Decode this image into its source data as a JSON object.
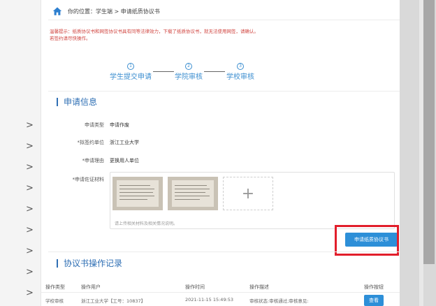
{
  "breadcrumb": {
    "prefix": "你的位置：",
    "path": "学生端 > 申请纸质协议书"
  },
  "notice": {
    "line1": "温馨提示：纸质协议书和网签协议书具有同等法律效力，下载了纸质协议书，就无法使用网签，请确认。",
    "line2": "若签约请尽快操作。"
  },
  "steps": [
    {
      "num": "1",
      "label": "学生提交申请"
    },
    {
      "num": "2",
      "label": "学院审核"
    },
    {
      "num": "3",
      "label": "学校审核"
    }
  ],
  "apply_section": {
    "title": "申请信息",
    "fields": [
      {
        "label": "申请类型",
        "value": "申请作废"
      },
      {
        "label": "*拟签约单位",
        "value": "浙江工业大学"
      },
      {
        "label": "*申请理由",
        "value": "更换用人单位"
      }
    ],
    "material_label": "*申请佐证材料",
    "add_icon": "+",
    "upload_hint": "请上传相关材料及相关情况说明。"
  },
  "apply_button": "申请纸质协议书",
  "records_section": {
    "title": "协议书操作记录",
    "columns": [
      "操作类型",
      "操作用户",
      "操作时间",
      "操作描述",
      "操作按钮"
    ],
    "rows": [
      {
        "type": "学校审核",
        "user": "浙江工业大学【工号：10837】",
        "time": "2021-11-15 15:49:53",
        "desc": "审核状态:审核通过;审核意见:",
        "action": "查看"
      }
    ]
  },
  "colors": {
    "accent": "#2d8fd8",
    "highlight": "#e21e2b",
    "notice": "#d0443f"
  },
  "icons": {
    "home": "home-icon",
    "chevron": "chevron-right-icon",
    "plus": "plus-icon"
  },
  "left_nav": {
    "chevron_count": 12,
    "glyph": ">"
  }
}
